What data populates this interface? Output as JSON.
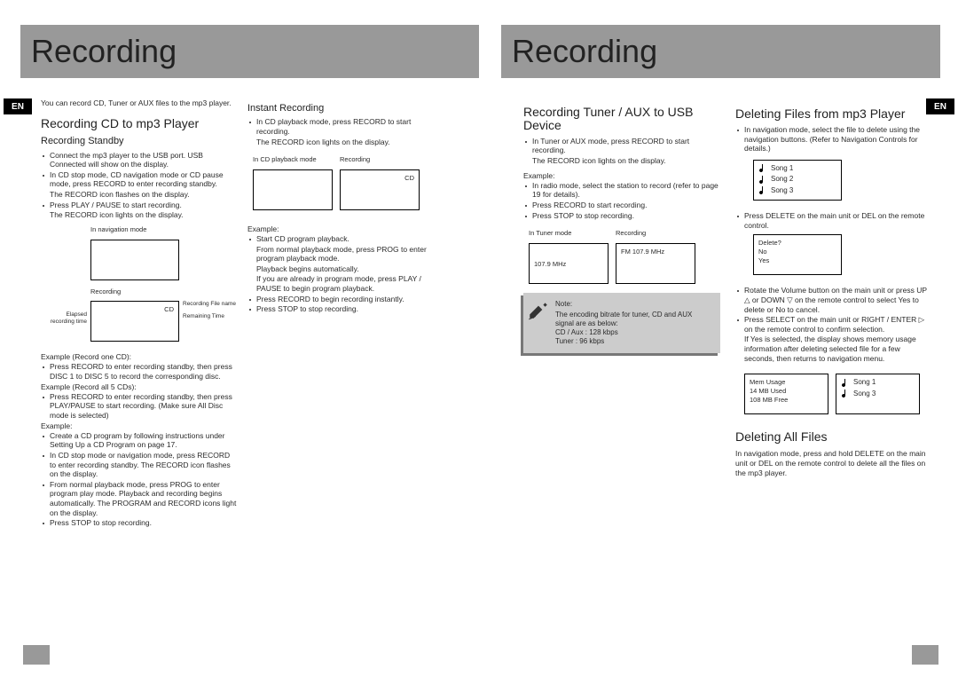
{
  "banners": {
    "left": "Recording",
    "right": "Recording"
  },
  "enTag": "EN",
  "col1": {
    "intro": "You can record CD, Tuner or AUX files to the mp3 player.",
    "h2": "Recording CD to mp3 Player",
    "h3": "Recording Standby",
    "b1": "Connect the mp3 player to the USB port. USB Connected will show on the display.",
    "b2": "In CD stop mode, CD navigation mode or CD pause mode, press RECORD to enter recording standby.",
    "s1": "The RECORD icon flashes on the display.",
    "b3": "Press PLAY / PAUSE to start recording.",
    "s2": "The RECORD icon lights on the display.",
    "navLabel": "In navigation mode",
    "recLabel": "Recording",
    "recBoxText": "CD",
    "callElapsed": "Elapsed recording time",
    "callFile": "Recording File name",
    "callRemain": "Remaining Time",
    "ex1h": "Example (Record one CD):",
    "ex1b": "Press RECORD to enter recording standby, then press DISC 1 to DISC 5 to record the corresponding disc.",
    "ex2h": "Example (Record all 5 CDs):",
    "ex2b": "Press RECORD to enter recording standby, then press PLAY/PAUSE to start recording. (Make sure All Disc mode is selected)",
    "ex3h": "Example:",
    "ex3b1": "Create a CD program by following instructions under Setting Up a CD Program on page 17.",
    "ex3b2": "In CD stop mode or navigation mode, press RECORD to enter recording standby. The RECORD icon flashes on the display.",
    "ex3b3": "From normal playback mode, press PROG to enter program play mode. Playback and recording begins automatically. The PROGRAM and RECORD icons light on the display.",
    "ex3b4": "Press STOP to stop recording."
  },
  "col2": {
    "h3": "Instant Recording",
    "b1": "In CD playback mode, press RECORD to start recording.",
    "s1": "The RECORD icon lights on the display.",
    "lab1": "In CD playback mode",
    "lab2": "Recording",
    "box2": "CD",
    "exh": "Example:",
    "exb1": "Start CD program playback.",
    "exs1": "From normal playback mode, press PROG to enter program playback mode.",
    "exs2": "Playback begins automatically.",
    "exn": "If you are already in program mode, press PLAY / PAUSE to begin program playback.",
    "exb2": "Press RECORD to begin recording instantly.",
    "exb3": "Press STOP to stop recording."
  },
  "col3": {
    "h2": "Recording Tuner / AUX to USB Device",
    "b1": "In Tuner or AUX mode, press RECORD to start recording.",
    "s1": "The RECORD icon lights on the display.",
    "exh": "Example:",
    "exb1": "In radio mode, select the station to record (refer to page 19 for details).",
    "exb2": "Press RECORD to start recording.",
    "exb3": "Press STOP to stop recording.",
    "lab1": "In Tuner mode",
    "lab2": "Recording",
    "box1": "107.9 MHz",
    "box2": "FM 107.9 MHz",
    "noteHeader": "Note:",
    "note1": "The encoding bitrate for tuner, CD and AUX signal are as below:",
    "note2": "CD / Aux : 128 kbps",
    "note3": "Tuner : 96 kbps"
  },
  "col4": {
    "h2": "Deleting Files from mp3 Player",
    "b1": "In navigation mode, select the file to delete using the navigation buttons. (Refer to Navigation Controls for details.)",
    "song1": "Song 1",
    "song2": "Song 2",
    "song3": "Song 3",
    "b2": "Press DELETE on the main unit or DEL on the remote control.",
    "delBox1": "Delete?",
    "delBox2": "No",
    "delBox3": "Yes",
    "b3": "Rotate the Volume button on the main unit or press UP △ or DOWN ▽ on the remote control to select Yes to delete or No to cancel.",
    "b4": "Press SELECT on the main unit or RIGHT / ENTER ▷ on the remote control to confirm selection.",
    "s4": "If Yes is selected, the display shows memory usage information after deleting selected file for a few seconds, then returns to navigation menu.",
    "memBox1": "Mem Usage",
    "memBox2": "14 MB Used",
    "memBox3": "108 MB Free",
    "songR1": "Song 1",
    "songR3": "Song 3",
    "h2b": "Deleting All Files",
    "pDelAll": "In navigation mode, press and hold DELETE on the main unit or DEL on the remote control to delete all the files on the mp3 player."
  }
}
